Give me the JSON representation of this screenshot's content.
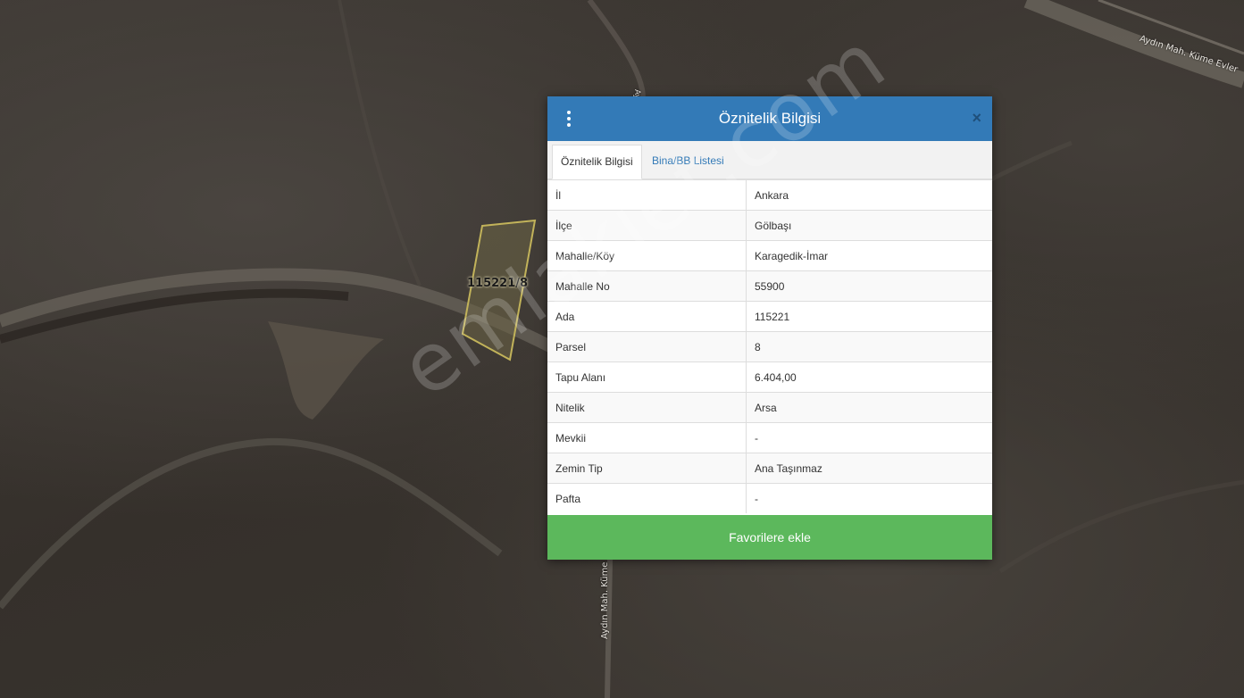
{
  "map": {
    "road_label_top_right": "Aydın Mah. Küme Evler",
    "road_label_vertical": "Aydın Mah. Küme",
    "road_label_vertical_top": "Ay",
    "parcel_label": "115221/8",
    "watermark": "emlakjet.com"
  },
  "dialog": {
    "title": "Öznitelik Bilgisi",
    "menu_icon": "vertical-dots-icon",
    "close_icon": "close-icon",
    "close_glyph": "×",
    "header_color": "#337ab7",
    "tabs": [
      {
        "label": "Öznitelik Bilgisi",
        "active": true
      },
      {
        "label": "Bina/BB Listesi",
        "active": false
      }
    ],
    "rows": [
      {
        "key": "İl",
        "value": "Ankara"
      },
      {
        "key": "İlçe",
        "value": "Gölbaşı"
      },
      {
        "key": "Mahalle/Köy",
        "value": "Karagedik-İmar"
      },
      {
        "key": "Mahalle No",
        "value": "55900"
      },
      {
        "key": "Ada",
        "value": "115221"
      },
      {
        "key": "Parsel",
        "value": "8"
      },
      {
        "key": "Tapu Alanı",
        "value": "6.404,00"
      },
      {
        "key": "Nitelik",
        "value": "Arsa"
      },
      {
        "key": "Mevkii",
        "value": "-"
      },
      {
        "key": "Zemin Tip",
        "value": "Ana Taşınmaz"
      },
      {
        "key": "Pafta",
        "value": "-"
      }
    ],
    "favorite_button": "Favorilere ekle",
    "favorite_color": "#5cb85c"
  }
}
